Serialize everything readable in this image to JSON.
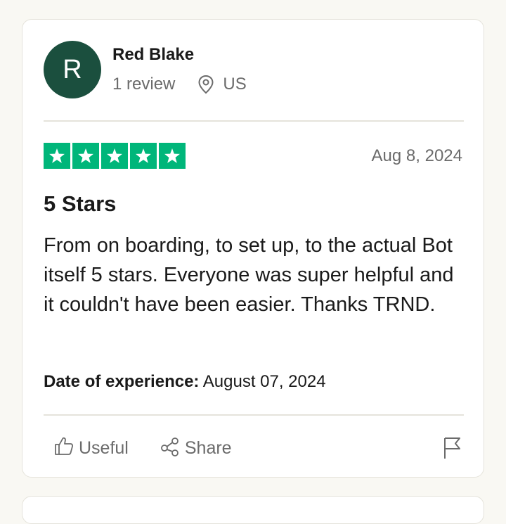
{
  "review": {
    "avatar_initial": "R",
    "reviewer_name": "Red Blake",
    "review_count": "1 review",
    "country": "US",
    "rating": 5,
    "rating_max": 5,
    "date": "Aug 8, 2024",
    "title": "5 Stars",
    "body": "From on boarding, to set up, to the actual Bot itself 5 stars. Everyone was super helpful and it couldn't have been easier. Thanks TRND.",
    "experience_label": "Date of experience:",
    "experience_date": "August 07, 2024"
  },
  "actions": {
    "useful_label": "Useful",
    "share_label": "Share"
  },
  "icons": {
    "location": "location-pin-icon",
    "star": "star-icon",
    "useful": "thumbs-up-icon",
    "share": "share-icon",
    "flag": "flag-icon"
  },
  "colors": {
    "star_green": "#00b67a",
    "avatar_bg": "#1b4f3e",
    "page_bg": "#f9f8f3"
  }
}
